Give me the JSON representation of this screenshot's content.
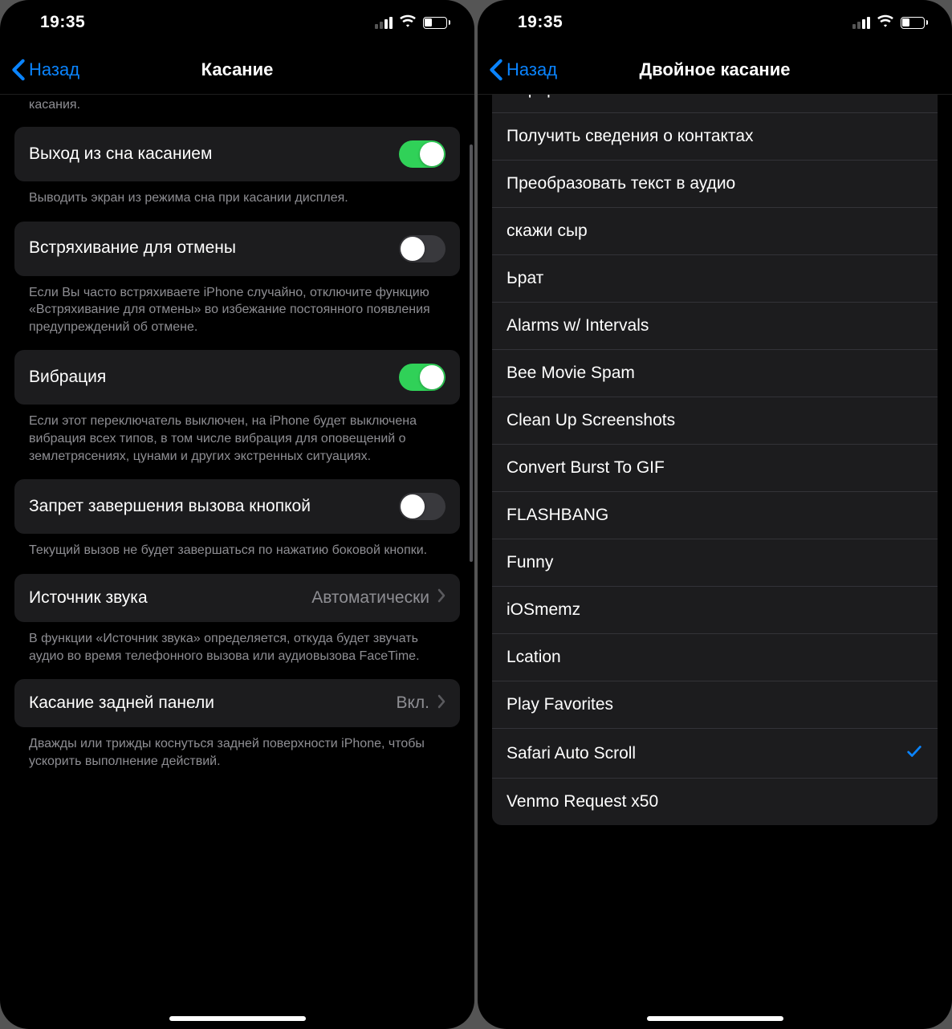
{
  "status": {
    "time": "19:35"
  },
  "left": {
    "back_label": "Назад",
    "title": "Касание",
    "truncated_text": "касания.",
    "rows": [
      {
        "label": "Выход из сна касанием",
        "type": "toggle",
        "on": true,
        "footer": "Выводить экран из режима сна при касании дисплея."
      },
      {
        "label": "Встряхивание для отмены",
        "type": "toggle",
        "on": false,
        "footer": "Если Вы часто встряхиваете iPhone случайно, отключите функцию «Встряхивание для отмены» во избежание постоянного появления предупреждений об отмене."
      },
      {
        "label": "Вибрация",
        "type": "toggle",
        "on": true,
        "footer": "Если этот переключатель выключен, на iPhone будет выключена вибрация всех типов, в том числе вибрация для оповещений о землетрясениях, цунами и других экстренных ситуациях."
      },
      {
        "label": "Запрет завершения вызова кнопкой",
        "type": "toggle",
        "on": false,
        "footer": "Текущий вызов не будет завершаться по нажатию боковой кнопки."
      },
      {
        "label": "Источник звука",
        "type": "link",
        "value": "Автоматически",
        "footer": "В функции «Источник звука» определяется, откуда будет звучать аудио во время телефонного вызова или аудиовызова FaceTime."
      },
      {
        "label": "Касание задней панели",
        "type": "link",
        "value": "Вкл.",
        "footer": "Дважды или трижды коснуться задней поверхности iPhone, чтобы ускорить выполнение действий."
      }
    ]
  },
  "right": {
    "back_label": "Назад",
    "title": "Двойное касание",
    "items": [
      {
        "label": "Перерыв"
      },
      {
        "label": "Получить сведения о контактах"
      },
      {
        "label": "Преобразовать текст в аудио"
      },
      {
        "label": "скажи сыр"
      },
      {
        "label": "Ьрат"
      },
      {
        "label": "Alarms w/ Intervals"
      },
      {
        "label": "Bee Movie Spam"
      },
      {
        "label": "Clean Up Screenshots"
      },
      {
        "label": "Convert Burst To GIF"
      },
      {
        "label": "FLASHBANG"
      },
      {
        "label": "Funny"
      },
      {
        "label": "iOSmemz"
      },
      {
        "label": "Lcation"
      },
      {
        "label": "Play Favorites"
      },
      {
        "label": "Safari Auto Scroll",
        "selected": true
      },
      {
        "label": "Venmo Request x50"
      }
    ]
  }
}
